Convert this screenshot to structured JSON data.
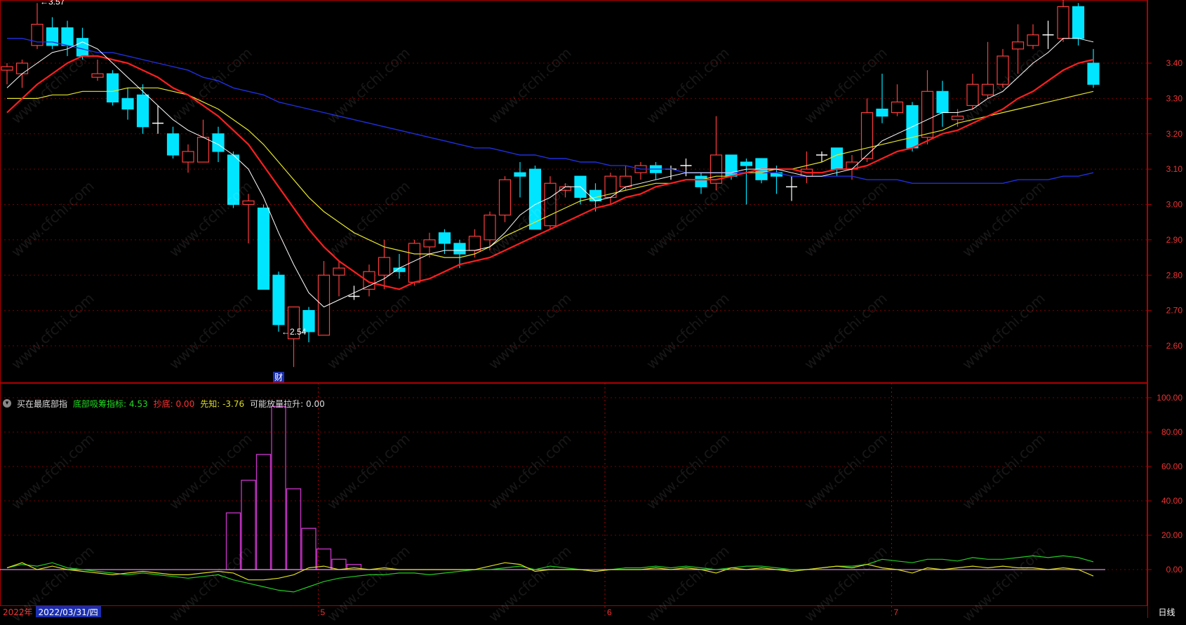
{
  "indicator_bar": {
    "name": "买在最底部指",
    "items": [
      {
        "label": "底部吸筹指标:",
        "value": "4.53",
        "color": "#22dd22"
      },
      {
        "label": "抄底:",
        "value": "0.00",
        "color": "#ff3333"
      },
      {
        "label": "先知:",
        "value": "-3.76",
        "color": "#dddd22"
      },
      {
        "label": "可能放量拉升:",
        "value": "0.00",
        "color": "#dddddd"
      }
    ]
  },
  "bottom": {
    "year": "2022年",
    "date": "2022/03/31/四",
    "period": "日线"
  },
  "watermark": "www.cfchi.com",
  "colors": {
    "up": "#ff3c3c",
    "down": "#00e5ff",
    "ma5": "#ffffff",
    "ma10": "#ff1e1e",
    "ma20": "#e5e52a",
    "ma60": "#1f2fe0",
    "grid": "#7a0000",
    "histogram": "#cc33cc",
    "line_green": "#22cc22",
    "line_yellow": "#dddd22"
  },
  "chart_data": [
    {
      "type": "candlestick",
      "ylim": [
        2.5,
        3.6
      ],
      "y_ticks": [
        "3.40",
        "3.30",
        "3.20",
        "3.10",
        "3.00",
        "2.90",
        "2.80",
        "2.70",
        "2.60"
      ],
      "x_tick_labels": [
        "5",
        "6",
        "7"
      ],
      "x_tick_index": [
        21,
        40,
        59
      ],
      "annotations": [
        {
          "text": "3.57",
          "index": 2
        },
        {
          "text": "2.54",
          "index": 18
        }
      ],
      "marker": {
        "text": "财",
        "index": 18
      },
      "candles": [
        [
          3.38,
          3.39,
          3.34,
          3.4
        ],
        [
          3.37,
          3.4,
          3.33,
          3.41
        ],
        [
          3.45,
          3.51,
          3.44,
          3.57
        ],
        [
          3.5,
          3.45,
          3.44,
          3.53
        ],
        [
          3.5,
          3.45,
          3.42,
          3.52
        ],
        [
          3.47,
          3.42,
          3.41,
          3.5
        ],
        [
          3.36,
          3.37,
          3.35,
          3.41
        ],
        [
          3.37,
          3.29,
          3.28,
          3.38
        ],
        [
          3.3,
          3.27,
          3.24,
          3.33
        ],
        [
          3.31,
          3.22,
          3.2,
          3.34
        ],
        [
          3.23,
          3.23,
          3.2,
          3.28
        ],
        [
          3.2,
          3.14,
          3.13,
          3.22
        ],
        [
          3.12,
          3.15,
          3.09,
          3.17
        ],
        [
          3.12,
          3.19,
          3.12,
          3.24
        ],
        [
          3.2,
          3.15,
          3.12,
          3.22
        ],
        [
          3.14,
          3.0,
          2.99,
          3.15
        ],
        [
          3.0,
          3.01,
          2.89,
          3.03
        ],
        [
          2.99,
          2.76,
          2.76,
          3.0
        ],
        [
          2.8,
          2.66,
          2.64,
          2.81
        ],
        [
          2.62,
          2.71,
          2.54,
          2.71
        ],
        [
          2.7,
          2.64,
          2.61,
          2.71
        ],
        [
          2.63,
          2.8,
          2.63,
          2.84
        ],
        [
          2.8,
          2.82,
          2.74,
          2.84
        ],
        [
          2.74,
          2.74,
          2.73,
          2.77
        ],
        [
          2.76,
          2.81,
          2.74,
          2.83
        ],
        [
          2.8,
          2.85,
          2.76,
          2.9
        ],
        [
          2.82,
          2.81,
          2.79,
          2.86
        ],
        [
          2.78,
          2.89,
          2.77,
          2.9
        ],
        [
          2.88,
          2.9,
          2.85,
          2.92
        ],
        [
          2.92,
          2.89,
          2.86,
          2.93
        ],
        [
          2.89,
          2.86,
          2.82,
          2.9
        ],
        [
          2.87,
          2.91,
          2.85,
          2.93
        ],
        [
          2.9,
          2.97,
          2.87,
          2.98
        ],
        [
          2.97,
          3.07,
          2.95,
          3.08
        ],
        [
          3.09,
          3.08,
          3.02,
          3.12
        ],
        [
          3.1,
          2.93,
          2.93,
          3.11
        ],
        [
          2.94,
          3.06,
          2.93,
          3.08
        ],
        [
          3.04,
          3.05,
          3.02,
          3.06
        ],
        [
          3.08,
          3.02,
          3.0,
          3.08
        ],
        [
          3.04,
          3.01,
          2.98,
          3.06
        ],
        [
          3.02,
          3.08,
          3.0,
          3.09
        ],
        [
          3.05,
          3.08,
          3.04,
          3.11
        ],
        [
          3.09,
          3.11,
          3.07,
          3.12
        ],
        [
          3.11,
          3.09,
          3.07,
          3.12
        ],
        [
          3.1,
          3.1,
          3.07,
          3.11
        ],
        [
          3.11,
          3.11,
          3.08,
          3.13
        ],
        [
          3.08,
          3.05,
          3.03,
          3.09
        ],
        [
          3.06,
          3.14,
          3.04,
          3.25
        ],
        [
          3.14,
          3.08,
          3.07,
          3.14
        ],
        [
          3.12,
          3.11,
          3.0,
          3.13
        ],
        [
          3.13,
          3.07,
          3.06,
          3.13
        ],
        [
          3.09,
          3.08,
          3.03,
          3.11
        ],
        [
          3.05,
          3.05,
          3.01,
          3.08
        ],
        [
          3.08,
          3.1,
          3.06,
          3.15
        ],
        [
          3.14,
          3.14,
          3.12,
          3.15
        ],
        [
          3.16,
          3.1,
          3.08,
          3.16
        ],
        [
          3.1,
          3.12,
          3.07,
          3.14
        ],
        [
          3.13,
          3.26,
          3.12,
          3.3
        ],
        [
          3.27,
          3.25,
          3.23,
          3.37
        ],
        [
          3.26,
          3.29,
          3.25,
          3.34
        ],
        [
          3.28,
          3.16,
          3.15,
          3.29
        ],
        [
          3.19,
          3.32,
          3.17,
          3.38
        ],
        [
          3.32,
          3.26,
          3.22,
          3.35
        ],
        [
          3.24,
          3.25,
          3.22,
          3.27
        ],
        [
          3.28,
          3.34,
          3.27,
          3.37
        ],
        [
          3.31,
          3.34,
          3.3,
          3.46
        ],
        [
          3.34,
          3.42,
          3.33,
          3.44
        ],
        [
          3.44,
          3.46,
          3.37,
          3.51
        ],
        [
          3.45,
          3.48,
          3.44,
          3.51
        ],
        [
          3.48,
          3.48,
          3.44,
          3.52
        ],
        [
          3.47,
          3.56,
          3.46,
          3.58
        ],
        [
          3.56,
          3.47,
          3.45,
          3.57
        ],
        [
          3.4,
          3.34,
          3.33,
          3.44
        ]
      ],
      "ma5": [
        3.33,
        3.37,
        3.4,
        3.43,
        3.44,
        3.46,
        3.44,
        3.4,
        3.36,
        3.32,
        3.28,
        3.24,
        3.21,
        3.19,
        3.17,
        3.14,
        3.1,
        3.02,
        2.92,
        2.83,
        2.75,
        2.71,
        2.73,
        2.75,
        2.77,
        2.79,
        2.82,
        2.84,
        2.86,
        2.87,
        2.87,
        2.87,
        2.88,
        2.92,
        2.97,
        3.0,
        3.02,
        3.05,
        3.05,
        3.01,
        3.02,
        3.05,
        3.06,
        3.07,
        3.08,
        3.09,
        3.09,
        3.09,
        3.09,
        3.1,
        3.1,
        3.1,
        3.09,
        3.08,
        3.08,
        3.09,
        3.1,
        3.14,
        3.18,
        3.2,
        3.22,
        3.24,
        3.26,
        3.26,
        3.27,
        3.3,
        3.32,
        3.36,
        3.4,
        3.43,
        3.47,
        3.47,
        3.46
      ],
      "ma10": [
        3.26,
        3.3,
        3.34,
        3.37,
        3.4,
        3.42,
        3.42,
        3.41,
        3.4,
        3.38,
        3.36,
        3.33,
        3.31,
        3.28,
        3.25,
        3.21,
        3.17,
        3.11,
        3.05,
        2.99,
        2.93,
        2.88,
        2.84,
        2.81,
        2.78,
        2.77,
        2.76,
        2.78,
        2.79,
        2.81,
        2.83,
        2.84,
        2.85,
        2.87,
        2.89,
        2.91,
        2.93,
        2.95,
        2.97,
        2.99,
        3.0,
        3.02,
        3.03,
        3.05,
        3.06,
        3.07,
        3.07,
        3.07,
        3.08,
        3.09,
        3.1,
        3.1,
        3.1,
        3.09,
        3.09,
        3.1,
        3.1,
        3.11,
        3.13,
        3.15,
        3.16,
        3.18,
        3.2,
        3.21,
        3.23,
        3.25,
        3.27,
        3.3,
        3.32,
        3.35,
        3.38,
        3.4,
        3.41
      ],
      "ma20": [
        3.3,
        3.3,
        3.3,
        3.31,
        3.31,
        3.32,
        3.32,
        3.32,
        3.33,
        3.33,
        3.33,
        3.32,
        3.31,
        3.29,
        3.27,
        3.24,
        3.21,
        3.17,
        3.12,
        3.07,
        3.02,
        2.98,
        2.95,
        2.92,
        2.9,
        2.88,
        2.87,
        2.86,
        2.86,
        2.85,
        2.85,
        2.86,
        2.88,
        2.91,
        2.93,
        2.95,
        2.97,
        2.99,
        3.01,
        3.02,
        3.03,
        3.04,
        3.05,
        3.06,
        3.06,
        3.07,
        3.07,
        3.08,
        3.08,
        3.09,
        3.09,
        3.1,
        3.1,
        3.11,
        3.12,
        3.14,
        3.15,
        3.16,
        3.17,
        3.18,
        3.19,
        3.2,
        3.21,
        3.23,
        3.24,
        3.25,
        3.26,
        3.27,
        3.28,
        3.29,
        3.3,
        3.31,
        3.32
      ],
      "ma60": [
        3.47,
        3.47,
        3.46,
        3.46,
        3.45,
        3.44,
        3.43,
        3.43,
        3.42,
        3.41,
        3.4,
        3.39,
        3.38,
        3.36,
        3.35,
        3.33,
        3.32,
        3.31,
        3.29,
        3.28,
        3.27,
        3.26,
        3.25,
        3.24,
        3.23,
        3.22,
        3.21,
        3.2,
        3.19,
        3.18,
        3.17,
        3.16,
        3.16,
        3.15,
        3.14,
        3.14,
        3.13,
        3.13,
        3.12,
        3.12,
        3.11,
        3.11,
        3.1,
        3.1,
        3.1,
        3.09,
        3.09,
        3.09,
        3.09,
        3.09,
        3.09,
        3.09,
        3.08,
        3.08,
        3.08,
        3.08,
        3.08,
        3.07,
        3.07,
        3.07,
        3.06,
        3.06,
        3.06,
        3.06,
        3.06,
        3.06,
        3.06,
        3.07,
        3.07,
        3.07,
        3.08,
        3.08,
        3.09
      ]
    },
    {
      "type": "bar",
      "title": "买在最底部指",
      "ylim": [
        -7,
        100
      ],
      "y_ticks": [
        "100.00",
        "80.00",
        "60.00",
        "40.00",
        "20.00",
        "0.00"
      ],
      "histogram": [
        0,
        0,
        0,
        0,
        0,
        0,
        0,
        0,
        0,
        0,
        0,
        0,
        0,
        0,
        0,
        33,
        52,
        67,
        95,
        47,
        24,
        12,
        6,
        3,
        0,
        0,
        0,
        0,
        0,
        0,
        0,
        0,
        0,
        0,
        0,
        0,
        0,
        0,
        0,
        0,
        0,
        0,
        0,
        0,
        0,
        0,
        0,
        0,
        0,
        0,
        0,
        0,
        0,
        0,
        0,
        0,
        0,
        0,
        0,
        0,
        0,
        0,
        0,
        0,
        0,
        0,
        0,
        0,
        0,
        0,
        0,
        0,
        0
      ],
      "series_green": [
        1,
        3,
        2,
        4,
        1,
        0,
        -1,
        -2,
        -3,
        -2,
        -3,
        -4,
        -5,
        -4,
        -3,
        -6,
        -8,
        -10,
        -12,
        -13,
        -10,
        -7,
        -5,
        -4,
        -3,
        -3,
        -2,
        -2,
        -3,
        -2,
        -1,
        0,
        0,
        1,
        2,
        0,
        2,
        1,
        0,
        -1,
        0,
        1,
        1,
        2,
        1,
        2,
        1,
        0,
        1,
        2,
        2,
        1,
        0,
        0,
        1,
        2,
        2,
        3,
        6,
        5,
        4,
        6,
        6,
        5,
        7,
        6,
        6,
        7,
        8,
        7,
        8,
        7,
        4.53
      ],
      "series_yellow": [
        1,
        4,
        0,
        2,
        0,
        -1,
        -2,
        -3,
        -2,
        -1,
        -2,
        -3,
        -3,
        -2,
        -1,
        -2,
        -6,
        -6,
        -5,
        -3,
        1,
        2,
        0,
        1,
        0,
        1,
        0,
        0,
        0,
        0,
        0,
        0,
        2,
        4,
        3,
        -1,
        0,
        0,
        0,
        -1,
        0,
        0,
        0,
        1,
        0,
        1,
        0,
        -2,
        1,
        0,
        1,
        0,
        -1,
        0,
        1,
        2,
        1,
        3,
        1,
        0,
        -2,
        1,
        0,
        1,
        2,
        1,
        2,
        1,
        1,
        0,
        1,
        0,
        -3.76
      ]
    }
  ]
}
